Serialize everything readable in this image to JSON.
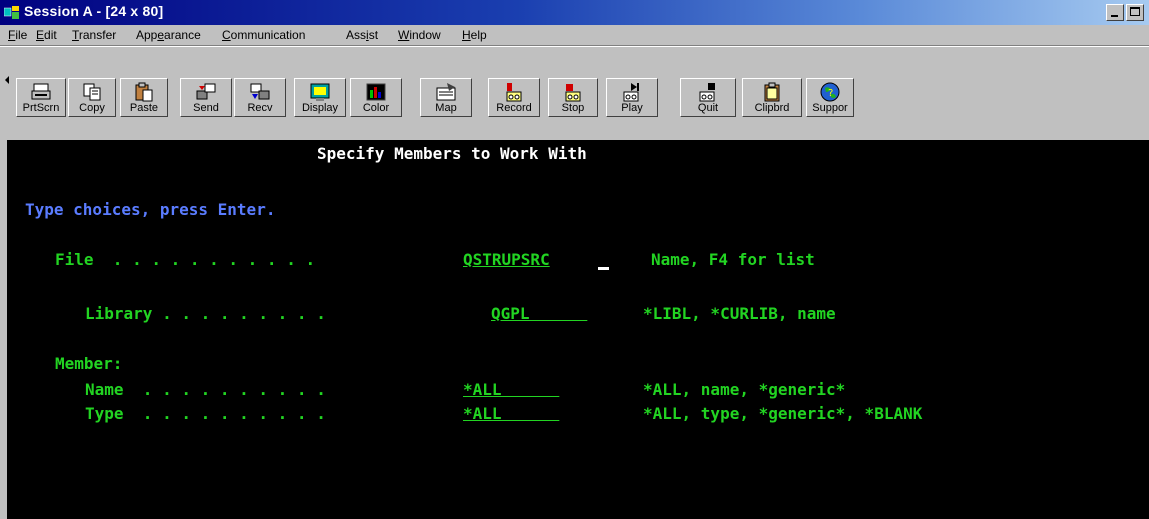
{
  "window": {
    "title": "Session A - [24 x 80]"
  },
  "menu": {
    "items": [
      {
        "pre": "",
        "ul": "F",
        "post": "ile"
      },
      {
        "pre": "",
        "ul": "E",
        "post": "dit"
      },
      {
        "pre": "",
        "ul": "T",
        "post": "ransfer"
      },
      {
        "pre": "App",
        "ul": "e",
        "post": "arance"
      },
      {
        "pre": "",
        "ul": "C",
        "post": "ommunication"
      },
      {
        "pre": "Ass",
        "ul": "i",
        "post": "st"
      },
      {
        "pre": "",
        "ul": "W",
        "post": "indow"
      },
      {
        "pre": "",
        "ul": "H",
        "post": "elp"
      }
    ]
  },
  "toolbar": {
    "buttons": [
      {
        "label": "PrtScrn",
        "icon": "printer-icon"
      },
      {
        "label": "Copy",
        "icon": "copy-icon"
      },
      {
        "label": "Paste",
        "icon": "paste-icon"
      },
      {
        "label": "Send",
        "icon": "send-icon"
      },
      {
        "label": "Recv",
        "icon": "receive-icon"
      },
      {
        "label": "Display",
        "icon": "display-icon"
      },
      {
        "label": "Color",
        "icon": "color-icon"
      },
      {
        "label": "Map",
        "icon": "map-icon"
      },
      {
        "label": "Record",
        "icon": "record-icon"
      },
      {
        "label": "Stop",
        "icon": "stop-icon"
      },
      {
        "label": "Play",
        "icon": "play-icon"
      },
      {
        "label": "Quit",
        "icon": "quit-icon"
      },
      {
        "label": "Clipbrd",
        "icon": "clipboard-icon"
      },
      {
        "label": "Suppor",
        "icon": "support-globe-icon"
      }
    ]
  },
  "screen": {
    "title": "Specify Members to Work With",
    "instruction": "Type choices, press Enter.",
    "file_label": "File  . . . . . . . . . . .",
    "file_value": "QSTRUPSRC",
    "file_help": "Name, F4 for list",
    "library_label": "Library . . . . . . . . .",
    "library_value": "QGPL      ",
    "library_help": "*LIBL, *CURLIB, name",
    "member_label": "Member:",
    "name_label": "Name  . . . . . . . . . .",
    "name_value": "*ALL      ",
    "name_help": "*ALL, name, *generic*",
    "type_label": "Type  . . . . . . . . . .",
    "type_value": "*ALL      ",
    "type_help": "*ALL, type, *generic*, *BLANK"
  },
  "colors": {
    "terminal_bg": "#000000",
    "field_green": "#22d422",
    "prompt_blue": "#5a7cff",
    "title_white": "#ffffff",
    "titlebar_blue": "#000080"
  }
}
